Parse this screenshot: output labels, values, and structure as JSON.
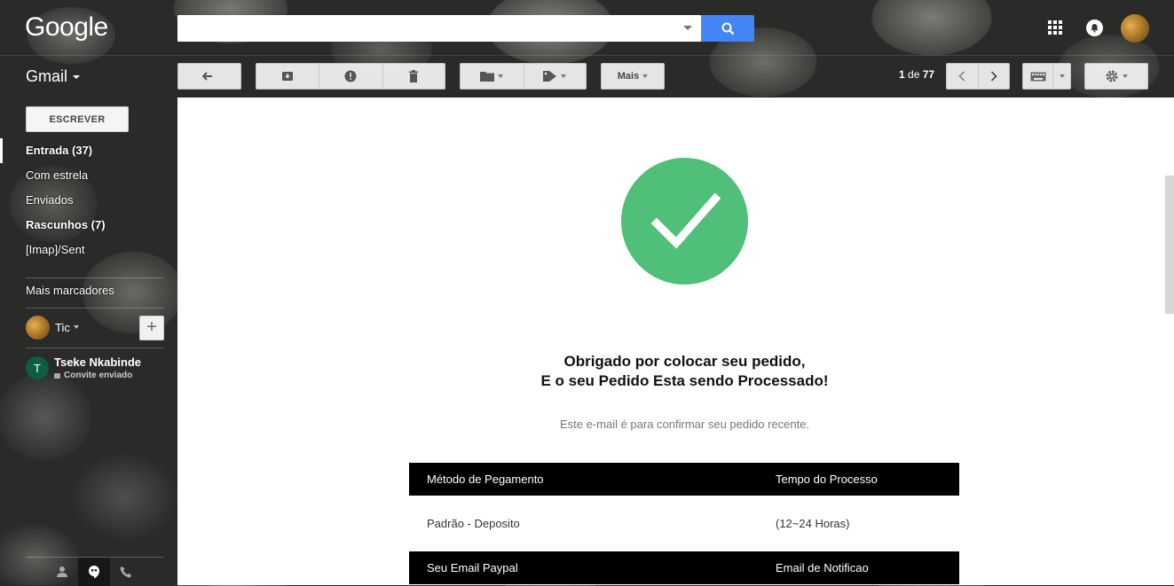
{
  "header": {
    "logo": "Google",
    "search": {
      "value": "",
      "placeholder": ""
    }
  },
  "app": {
    "label": "Gmail"
  },
  "toolbar": {
    "more_label": "Mais",
    "pager": {
      "current": "1",
      "of_label": "de",
      "total": "77"
    }
  },
  "sidebar": {
    "compose_label": "ESCREVER",
    "items": [
      {
        "label": "Entrada (37)",
        "bold": true,
        "active": true
      },
      {
        "label": "Com estrela",
        "bold": false
      },
      {
        "label": "Enviados",
        "bold": false
      },
      {
        "label": "Rascunhos (7)",
        "bold": true
      },
      {
        "label": "[Imap]/Sent",
        "bold": false
      }
    ],
    "more_labels": "Mais marcadores",
    "hangouts_user": "Tic",
    "contact": {
      "initial": "T",
      "name": "Tseke Nkabinde",
      "status": "Convite enviado"
    }
  },
  "email": {
    "heading_line1": "Obrigado por colocar seu pedido,",
    "heading_line2": "E o seu Pedido Esta sendo Processado!",
    "subtext": "Este e-mail é para confirmar seu pedido recente.",
    "table1": {
      "headers": [
        "Método de Pegamento",
        "Tempo do Processo"
      ],
      "row": [
        "Padrão - Deposito",
        "(12~24 Horas)"
      ]
    },
    "table2": {
      "headers": [
        "Seu Email Paypal",
        "Email de Notificao"
      ]
    }
  },
  "colors": {
    "accent": "#4285f4",
    "success": "#4fbf79",
    "table_header": "#000000"
  }
}
